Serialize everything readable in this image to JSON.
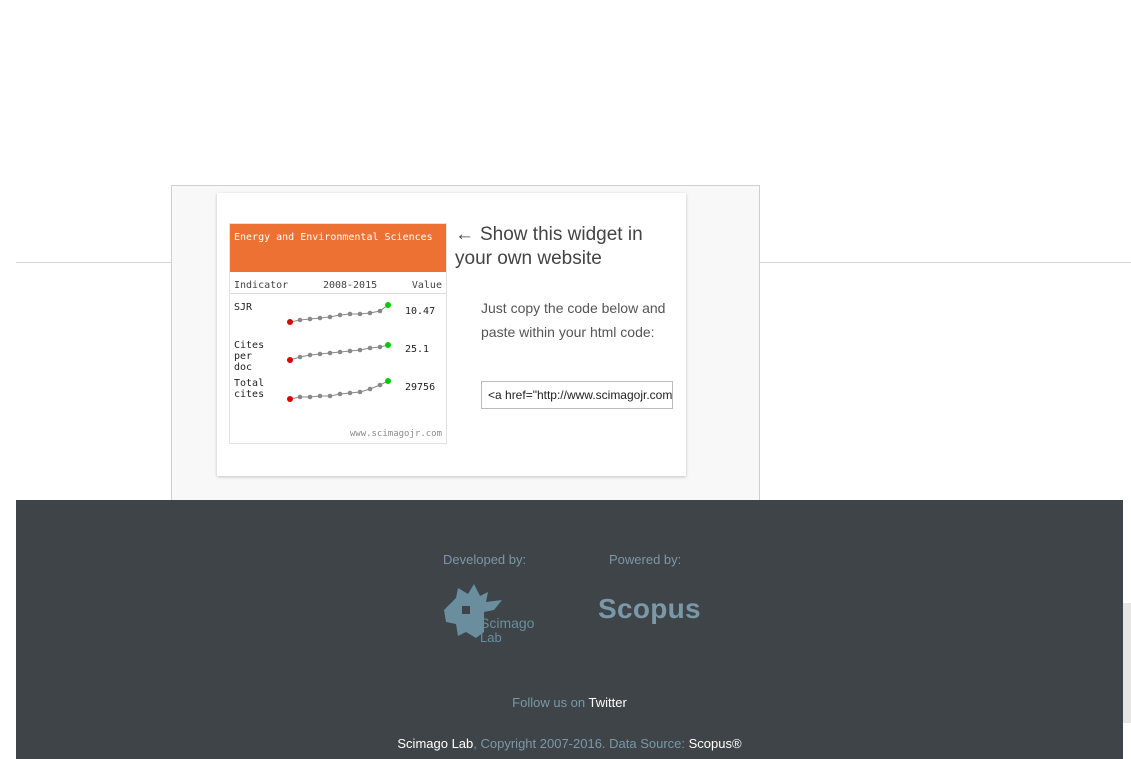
{
  "widget": {
    "mini": {
      "title": "Energy and Environmental Sciences",
      "col_indicator": "Indicator",
      "col_years": "2008-2015",
      "col_value": "Value",
      "rows": [
        {
          "name": "SJR",
          "value": "10.47"
        },
        {
          "name": "Cites per doc",
          "value": "25.1"
        },
        {
          "name": "Total cites",
          "value": "29756"
        }
      ],
      "footer": "www.scimagojr.com"
    },
    "arrow_icon": "left-arrow-icon",
    "heading": "Show this widget in your own website",
    "instructions": "Just copy the code below and paste within your html code:",
    "code_value": "<a href=\"http://www.scimagojr.com"
  },
  "footer": {
    "developed_by": "Developed by:",
    "powered_by": "Powered by:",
    "scimago_logo_text_1": "Scimago",
    "scimago_logo_text_2": "Lab",
    "scopus_logo": "Scopus",
    "follow_prefix": "Follow us on",
    "twitter_link": "Twitter",
    "copyright_lab_link": "Scimago Lab",
    "copyright_text": ", Copyright 2007-2016. Data Source: ",
    "scopus_link": "Scopus®"
  },
  "colors": {
    "accent": "#ec7132",
    "footer_bg": "#3e4448",
    "footer_muted": "#7a98a8",
    "point_start": "#e00000",
    "point_end": "#00cc00"
  }
}
